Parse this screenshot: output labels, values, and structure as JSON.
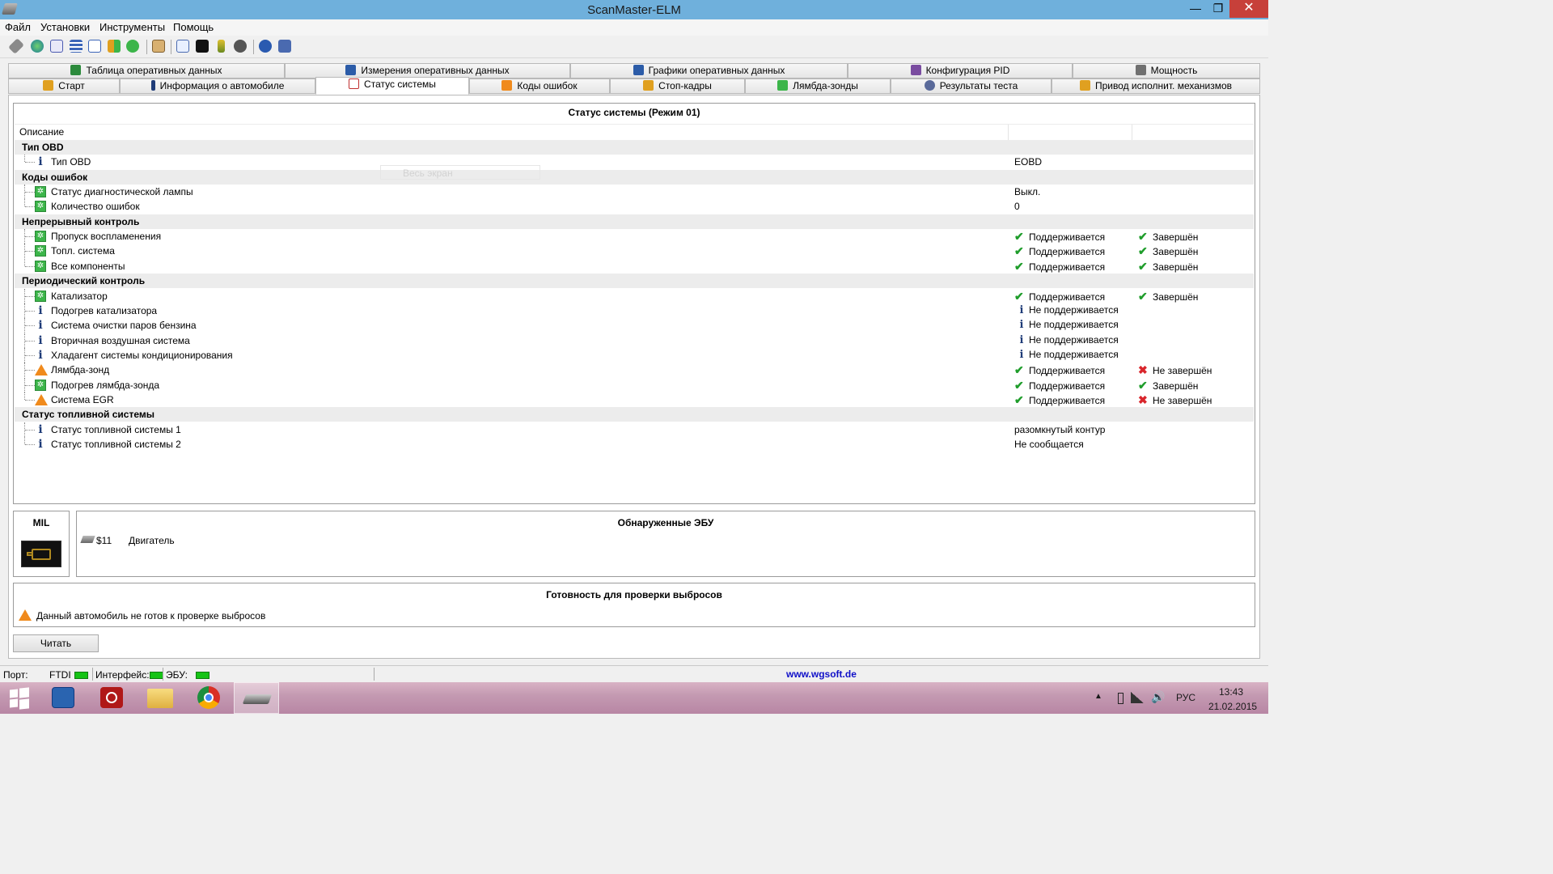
{
  "window": {
    "title": "ScanMaster-ELM",
    "minimize": "—",
    "maximize": "❐",
    "close": "✕"
  },
  "menu": [
    "Файл",
    "Установки",
    "Инструменты",
    "Помощь"
  ],
  "tabs_row1": [
    {
      "label": "Таблица оперативных данных",
      "icon": "table-icon",
      "color": "#2c8a3c"
    },
    {
      "label": "Измерения оперативных данных",
      "icon": "grid-icon",
      "color": "#2c5ca8"
    },
    {
      "label": "Графики оперативных данных",
      "icon": "chart-icon",
      "color": "#2c5ca8"
    },
    {
      "label": "Конфигурация PID",
      "icon": "doc-icon",
      "color": "#7a4ca0"
    },
    {
      "label": "Мощность",
      "icon": "chip-icon",
      "color": "#707070"
    }
  ],
  "tabs_row2": [
    {
      "label": "Старт",
      "icon": "start-icon",
      "color": "#e0a020"
    },
    {
      "label": "Информация о автомобиле",
      "icon": "info-icon",
      "color": "#1f3c78"
    },
    {
      "label": "Статус системы",
      "icon": "status-icon",
      "color": "#c03030",
      "active": true
    },
    {
      "label": "Коды ошибок",
      "icon": "warning-icon",
      "color": "#f08a1c"
    },
    {
      "label": "Стоп-кадры",
      "icon": "hand-icon",
      "color": "#e0a020"
    },
    {
      "label": "Лямбда-зонды",
      "icon": "sensor-icon",
      "color": "#3cb54a"
    },
    {
      "label": "Результаты теста",
      "icon": "gear-icon",
      "color": "#5a6a9a"
    },
    {
      "label": "Привод исполнит. механизмов",
      "icon": "hand-icon",
      "color": "#e0a020"
    }
  ],
  "status": {
    "title": "Статус системы (Режим 01)",
    "col_description": "Описание",
    "ghost_text": "Весь экран",
    "groups": [
      {
        "name": "Тип OBD",
        "items": [
          {
            "label": "Тип OBD",
            "icon": "info",
            "value": "EOBD"
          }
        ]
      },
      {
        "name": "Коды ошибок",
        "items": [
          {
            "label": "Статус диагностической лампы",
            "icon": "green",
            "value": "Выкл."
          },
          {
            "label": "Количество ошибок",
            "icon": "green",
            "value": "0"
          }
        ]
      },
      {
        "name": "Непрерывный контроль",
        "items": [
          {
            "label": "Пропуск воспламенения",
            "icon": "green",
            "support": "Поддерживается",
            "support_icon": "check",
            "complete": "Завершён",
            "complete_icon": "check"
          },
          {
            "label": "Топл. система",
            "icon": "green",
            "support": "Поддерживается",
            "support_icon": "check",
            "complete": "Завершён",
            "complete_icon": "check"
          },
          {
            "label": "Все компоненты",
            "icon": "green",
            "support": "Поддерживается",
            "support_icon": "check",
            "complete": "Завершён",
            "complete_icon": "check"
          }
        ]
      },
      {
        "name": "Периодический контроль",
        "items": [
          {
            "label": "Катализатор",
            "icon": "green",
            "support": "Поддерживается",
            "support_icon": "check",
            "complete": "Завершён",
            "complete_icon": "check"
          },
          {
            "label": "Подогрев катализатора",
            "icon": "info",
            "support": "Не поддерживается",
            "support_icon": "info"
          },
          {
            "label": "Система очистки паров бензина",
            "icon": "info",
            "support": "Не поддерживается",
            "support_icon": "info"
          },
          {
            "label": "Вторичная воздушная система",
            "icon": "info",
            "support": "Не поддерживается",
            "support_icon": "info"
          },
          {
            "label": "Хладагент системы кондиционирования",
            "icon": "info",
            "support": "Не поддерживается",
            "support_icon": "info"
          },
          {
            "label": "Лямбда-зонд",
            "icon": "warn",
            "support": "Поддерживается",
            "support_icon": "check",
            "complete": "Не завершён",
            "complete_icon": "cross"
          },
          {
            "label": "Подогрев лямбда-зонда",
            "icon": "green",
            "support": "Поддерживается",
            "support_icon": "check",
            "complete": "Завершён",
            "complete_icon": "check"
          },
          {
            "label": "Система EGR",
            "icon": "warn",
            "support": "Поддерживается",
            "support_icon": "check",
            "complete": "Не завершён",
            "complete_icon": "cross"
          }
        ]
      },
      {
        "name": "Статус топливной системы",
        "items": [
          {
            "label": "Статус топливной системы 1",
            "icon": "info",
            "value": "разомкнутый контур"
          },
          {
            "label": "Статус топливной системы 2",
            "icon": "info",
            "value": "Не сообщается"
          }
        ]
      }
    ]
  },
  "mil": {
    "title": "MIL",
    "icon": "engine-icon"
  },
  "ecu": {
    "title": "Обнаруженные ЭБУ",
    "items": [
      {
        "id": "$11",
        "name": "Двигатель",
        "icon": "chip-icon"
      }
    ]
  },
  "readiness": {
    "title": "Готовность для проверки выбросов",
    "message": "Данный автомобиль не готов к проверке выбросов"
  },
  "read_button": "Читать",
  "statusbar": {
    "port_label": "Порт:",
    "ftdi": "FTDI",
    "interface": "Интерфейс:",
    "ecu": "ЭБУ:",
    "url": "www.wgsoft.de",
    "url_color": "#1010c8"
  },
  "taskbar": {
    "lang": "РУС",
    "time": "13:43",
    "date": "21.02.2015"
  }
}
